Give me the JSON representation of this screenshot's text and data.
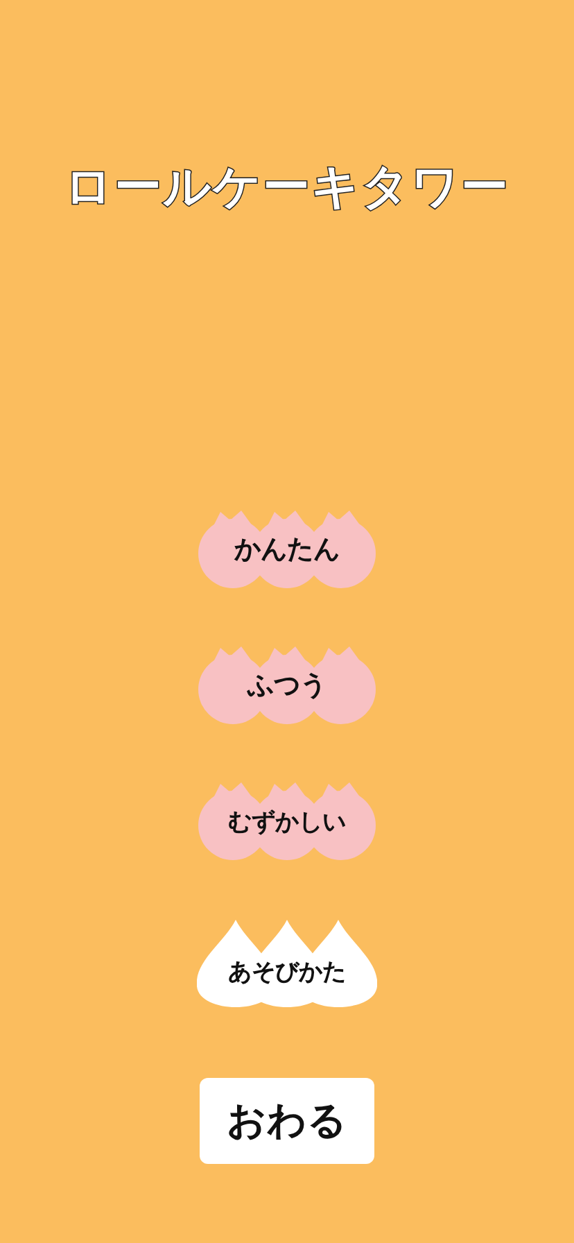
{
  "title": "ロールケーキタワー",
  "menu": [
    {
      "label": "かんたん",
      "kind": "peach"
    },
    {
      "label": "ふつう",
      "kind": "peach"
    },
    {
      "label": "むずかしい",
      "kind": "peach"
    },
    {
      "label": "あそびかた",
      "kind": "drop"
    },
    {
      "label": "おわる",
      "kind": "plain"
    }
  ]
}
